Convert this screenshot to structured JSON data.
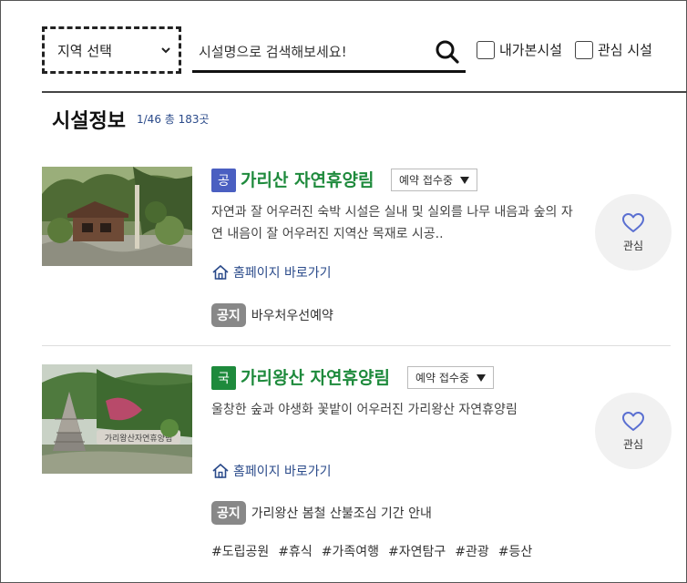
{
  "filter": {
    "region_label": "지역 선택",
    "search_placeholder": "시설명으로 검색해보세요!",
    "my_visited_label": "내가본시설",
    "favorites_label": "관심 시설"
  },
  "listing": {
    "title": "시설정보",
    "count": "1/46 총 183곳"
  },
  "facilities": [
    {
      "badge": "공",
      "badge_color": "#4a5fc1",
      "name": "가리산 자연휴양림",
      "status": "예약 접수중",
      "description": " 자연과 잘 어우러진 숙박 시설은 실내 및 실외를 나무 내음과 숲의 자연 내음이 잘 어우러진 지역산 목재로 시공..",
      "homepage_link": "홈페이지 바로가기",
      "notice_badge": "공지",
      "notice_text": "바우처우선예약",
      "favorite_label": "관심"
    },
    {
      "badge": "국",
      "badge_color": "#1e8a3c",
      "name": "가리왕산 자연휴양림",
      "status": "예약 접수중",
      "description": "울창한 숲과 야생화 꽃밭이 어우러진 가리왕산 자연휴양림",
      "photo_sign_text": "가리왕산자연휴양림",
      "homepage_link": "홈페이지 바로가기",
      "notice_badge": "공지",
      "notice_text": "가리왕산 봄철 산불조심 기간 안내",
      "favorite_label": "관심",
      "tags": [
        "#도립공원",
        "#휴식",
        "#가족여행",
        "#자연탐구",
        "#관광",
        "#등산"
      ]
    }
  ],
  "colors": {
    "facility_name": "#1e8a3c",
    "link": "#2a4a8a",
    "favorite_heart": "#5a6fd1"
  }
}
